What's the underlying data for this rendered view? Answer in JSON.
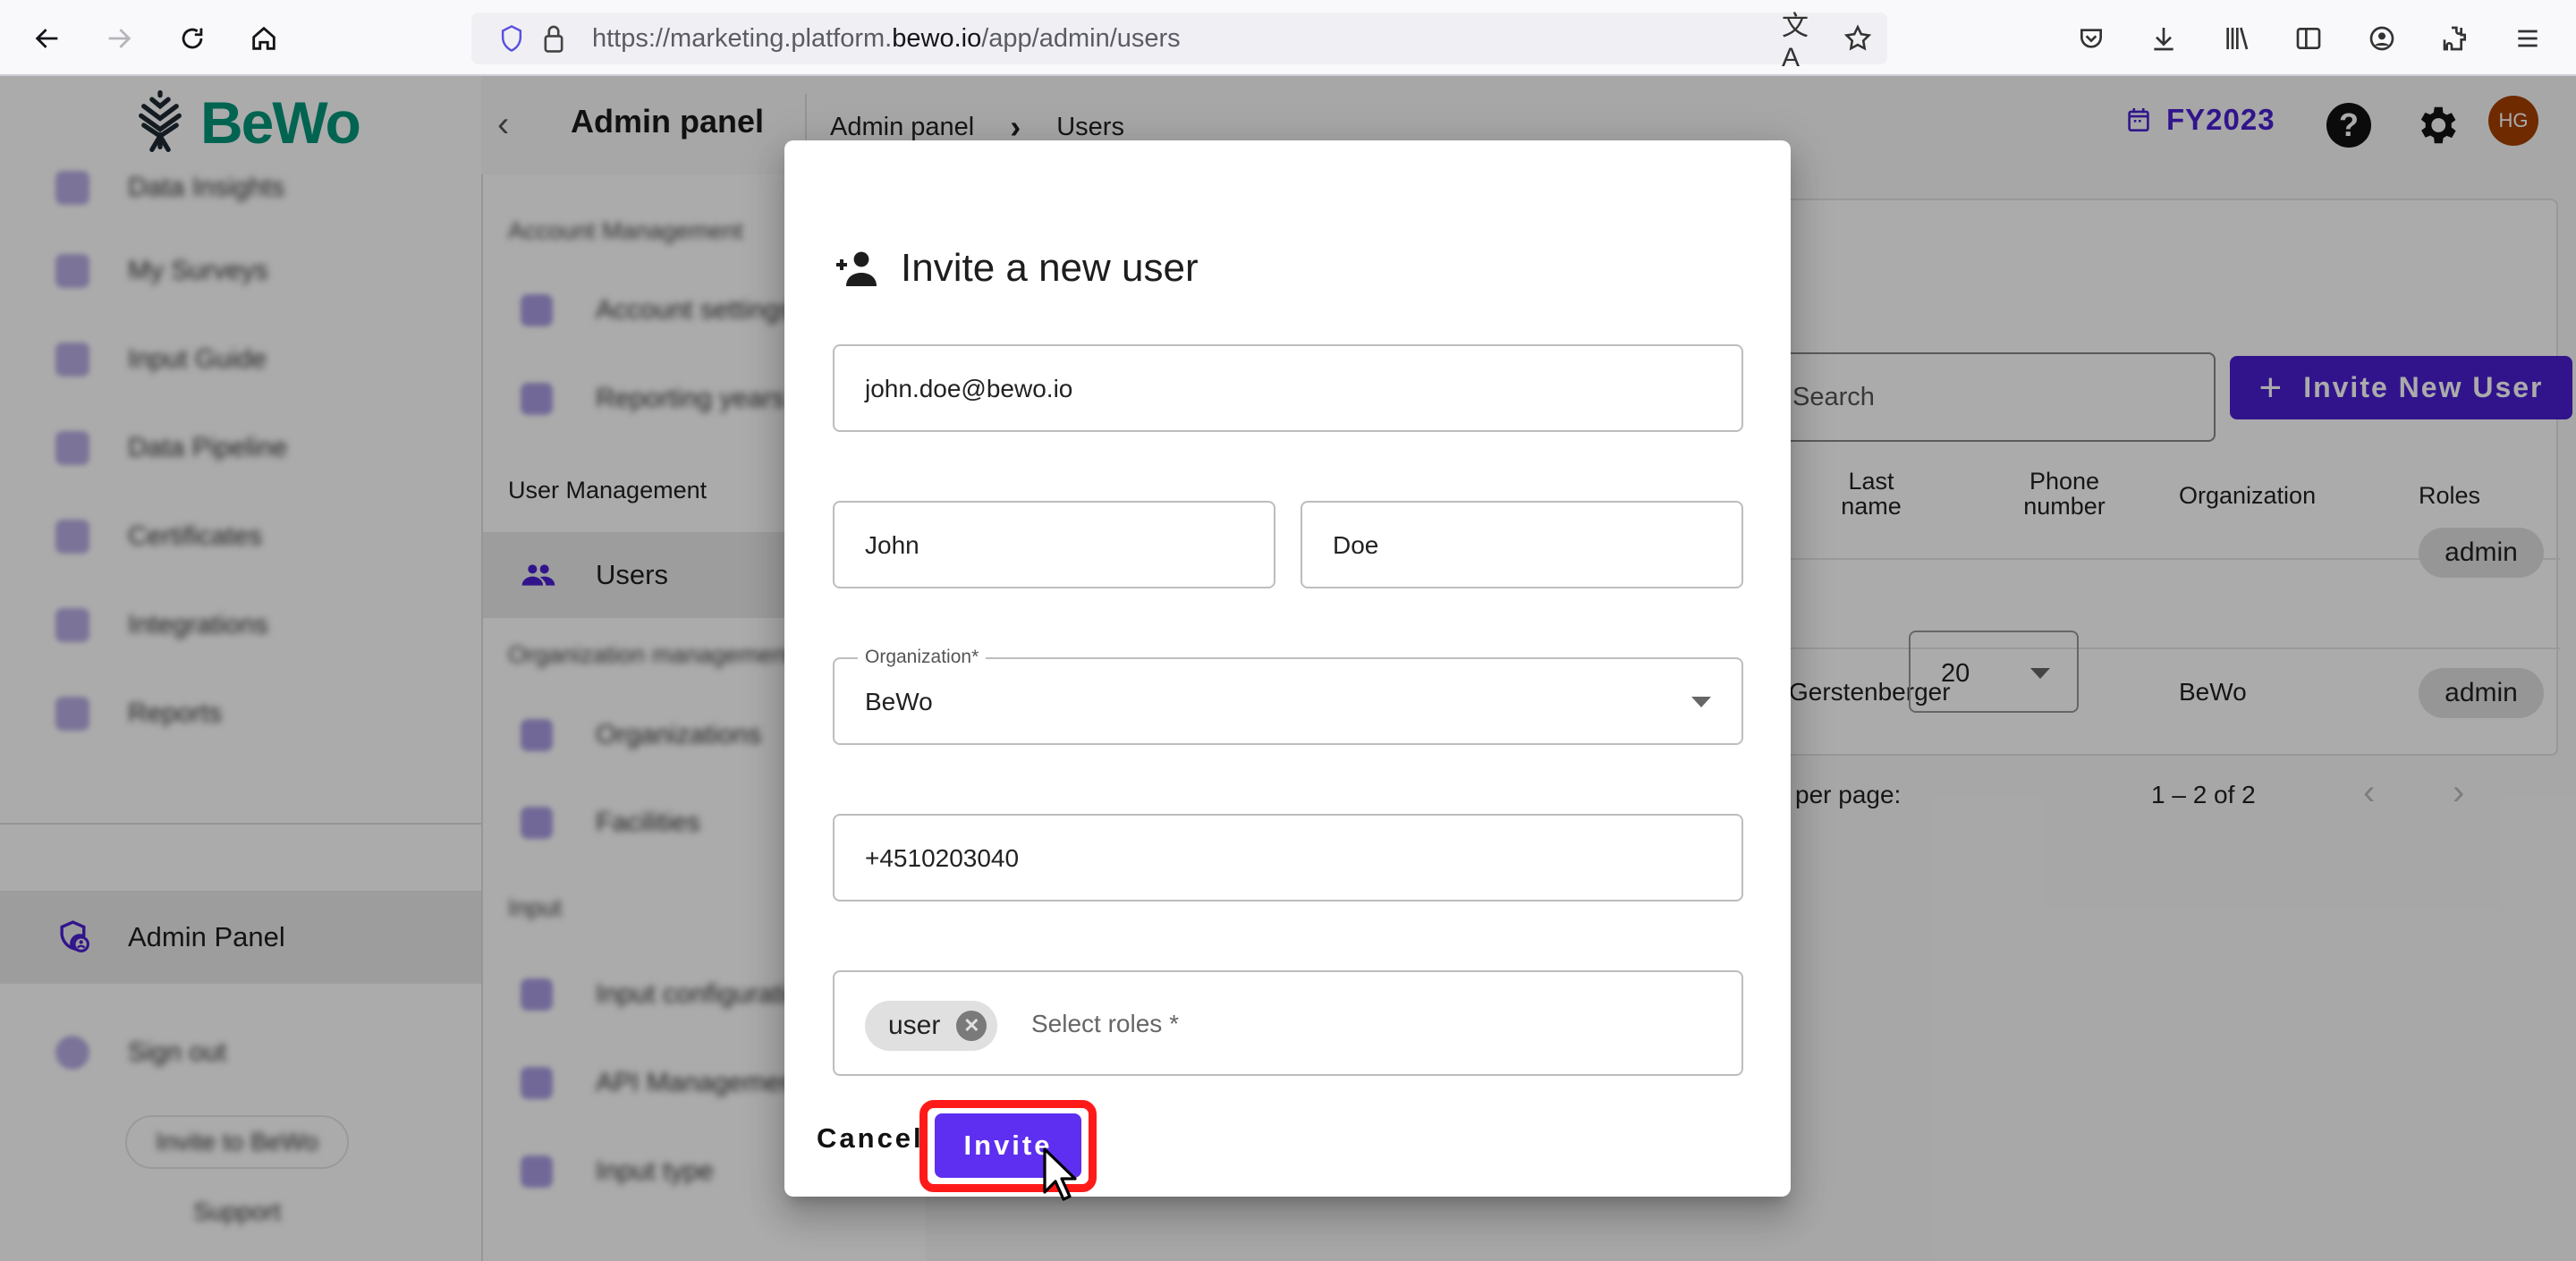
{
  "browser": {
    "url_prefix": "https://marketing.platform.",
    "url_domain": "bewo.io",
    "url_path": "/app/admin/users"
  },
  "app": {
    "logo_text": "BeWo",
    "header": {
      "title": "Admin panel",
      "breadcrumb": [
        "Admin panel",
        "Users"
      ],
      "fiscal_year": "FY2023",
      "avatar_initials": "HG"
    },
    "sidebar": {
      "items": [
        {
          "label": "Data Insights"
        },
        {
          "label": "My Surveys"
        },
        {
          "label": "Input Guide"
        },
        {
          "label": "Data Pipeline"
        },
        {
          "label": "Certificates"
        },
        {
          "label": "Integrations"
        },
        {
          "label": "Reports"
        }
      ],
      "admin_panel": "Admin Panel",
      "sign_out": "Sign out",
      "invite_button": "Invite to BeWo",
      "support": "Support"
    },
    "panel": {
      "sections": {
        "account": "Account Management",
        "user": "User Management",
        "organization": "Organization management",
        "input": "Input"
      },
      "items": {
        "account_settings": "Account settings",
        "reporting_years": "Reporting years",
        "users": "Users",
        "organizations": "Organizations",
        "facilities": "Facilities",
        "input_configuration": "Input configuration",
        "api_management": "API Management",
        "input_type": "Input type"
      }
    },
    "users_table": {
      "search_placeholder": "Search",
      "invite_new_user": "Invite New User",
      "columns": {
        "last_name": "Last name",
        "phone": "Phone number",
        "organization": "Organization",
        "roles": "Roles"
      },
      "rows": [
        {
          "last_name": "",
          "phone": "",
          "organization": "",
          "role": "admin"
        },
        {
          "last_name": "Gerstenberger",
          "phone": "",
          "organization": "BeWo",
          "role": "admin"
        }
      ],
      "rows_per_page_label": "per page:",
      "rows_per_page": "20",
      "range": "1 – 2 of 2"
    }
  },
  "modal": {
    "title": "Invite a new user",
    "email": "john.doe@bewo.io",
    "first_name": "John",
    "last_name": "Doe",
    "organization_label": "Organization*",
    "organization": "BeWo",
    "phone": "+4510203040",
    "roles_selected": [
      "user"
    ],
    "roles_placeholder": "Select roles *",
    "cancel": "Cancel",
    "invite": "Invite"
  },
  "colors": {
    "brand_green": "#00957a",
    "primary": "#4a1fd1",
    "invite_button": "#5e2ff0",
    "highlight": "#ff1a1a",
    "avatar": "#a63f00"
  }
}
